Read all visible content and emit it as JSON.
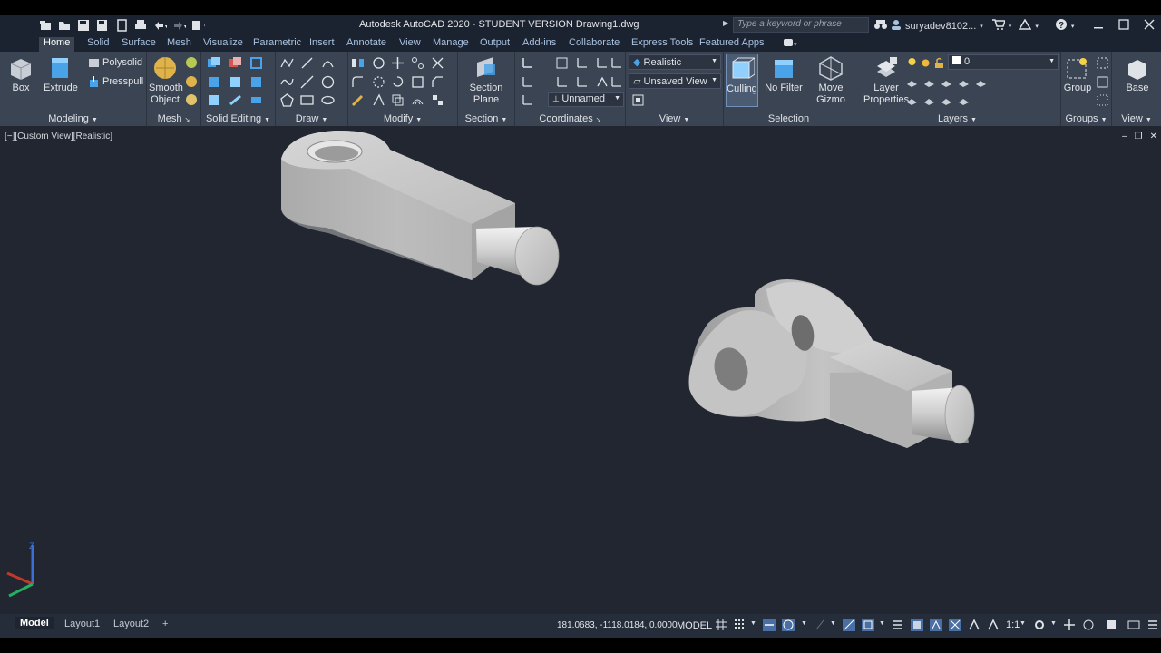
{
  "titlebar": {
    "title": "Autodesk AutoCAD 2020 - STUDENT VERSION    Drawing1.dwg",
    "search_placeholder": "Type a keyword or phrase",
    "user": "suryadev8102...",
    "qat_icons": [
      "new-icon",
      "open-icon",
      "save-icon",
      "saveas-icon",
      "plot-publish-icon",
      "print-icon",
      "undo-icon",
      "redo-icon",
      "workspace-icon"
    ]
  },
  "tabs": [
    "Home",
    "Solid",
    "Surface",
    "Mesh",
    "Visualize",
    "Parametric",
    "Insert",
    "Annotate",
    "View",
    "Manage",
    "Output",
    "Add-ins",
    "Collaborate",
    "Express Tools",
    "Featured Apps"
  ],
  "ribbon": {
    "modeling": {
      "label": "Modeling",
      "box": "Box",
      "extrude": "Extrude",
      "polysolid": "Polysolid",
      "presspull": "Presspull"
    },
    "mesh": {
      "label": "Mesh",
      "smooth1": "Smooth",
      "smooth2": "Object"
    },
    "solid_editing": {
      "label": "Solid Editing"
    },
    "draw": {
      "label": "Draw"
    },
    "modify": {
      "label": "Modify"
    },
    "section": {
      "label": "Section",
      "plane1": "Section",
      "plane2": "Plane"
    },
    "coordinates": {
      "label": "Coordinates",
      "ucs_value": "Unnamed"
    },
    "view": {
      "label": "View",
      "visual_style": "Realistic",
      "named_view": "Unsaved View"
    },
    "selection": {
      "label": "Selection",
      "culling": "Culling",
      "nofilter": "No Filter",
      "move1": "Move",
      "move2": "Gizmo"
    },
    "layers": {
      "label": "Layers",
      "layer_props1": "Layer",
      "layer_props2": "Properties",
      "current_layer": "0"
    },
    "groups": {
      "label": "Groups",
      "group": "Group"
    },
    "viewpanel": {
      "label": "View",
      "base": "Base"
    }
  },
  "viewport": {
    "label": "[−][Custom View][Realistic]"
  },
  "status": {
    "tabs": [
      "Model",
      "Layout1",
      "Layout2"
    ],
    "add_tab": "+",
    "coords": "181.0683, -1118.0184, 0.0000",
    "model": "MODEL",
    "scale": "1:1"
  },
  "colors": {
    "accent": "#4a6fa5",
    "viewport_bg": "#212630",
    "ribbon_bg": "#3b4453"
  }
}
